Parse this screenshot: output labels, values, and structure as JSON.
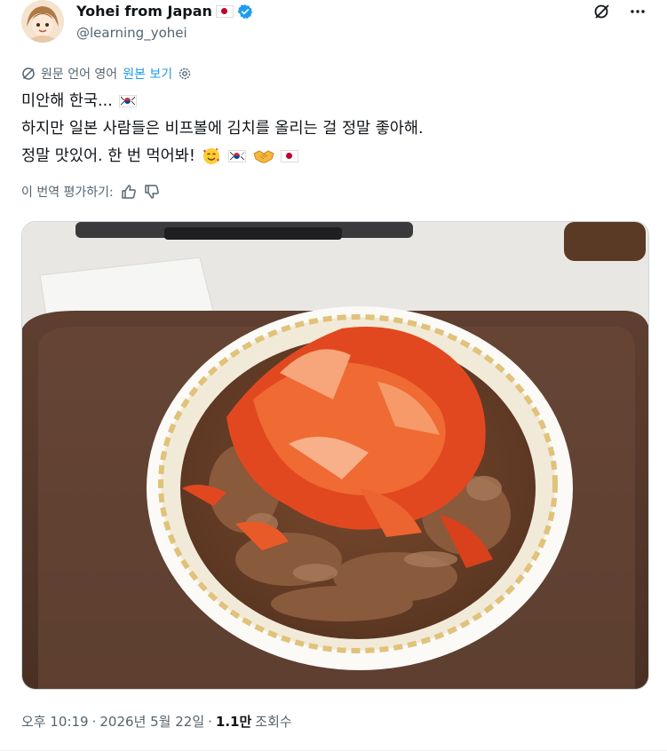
{
  "tweet": {
    "display_name": "Yohei from Japan",
    "handle": "@learning_yohei",
    "text_lines": [
      "미안해 한국...",
      "하지만 일본 사람들은 비프볼에 김치를 올리는 걸 정말 좋아해.",
      "정말 맛있어. 한 번 먹어봐!"
    ],
    "translation_label": "원문 언어 영어",
    "show_original": "원본 보기",
    "rate_translation": "이 번역 평가하기:",
    "time": "오후 10:19",
    "date": "2026년 5월 22일",
    "views_count": "1.1만",
    "views_label": "조회수"
  },
  "icons": {
    "verified": "verified-badge-icon",
    "grok": "grok-icon",
    "more": "more-icon",
    "translate": "translate-icon",
    "settings": "settings-icon",
    "thumbs_up": "thumbs-up-icon",
    "thumbs_down": "thumbs-down-icon"
  },
  "colors": {
    "accent": "#1d9bf0",
    "text": "#0f1419",
    "muted": "#536471"
  }
}
